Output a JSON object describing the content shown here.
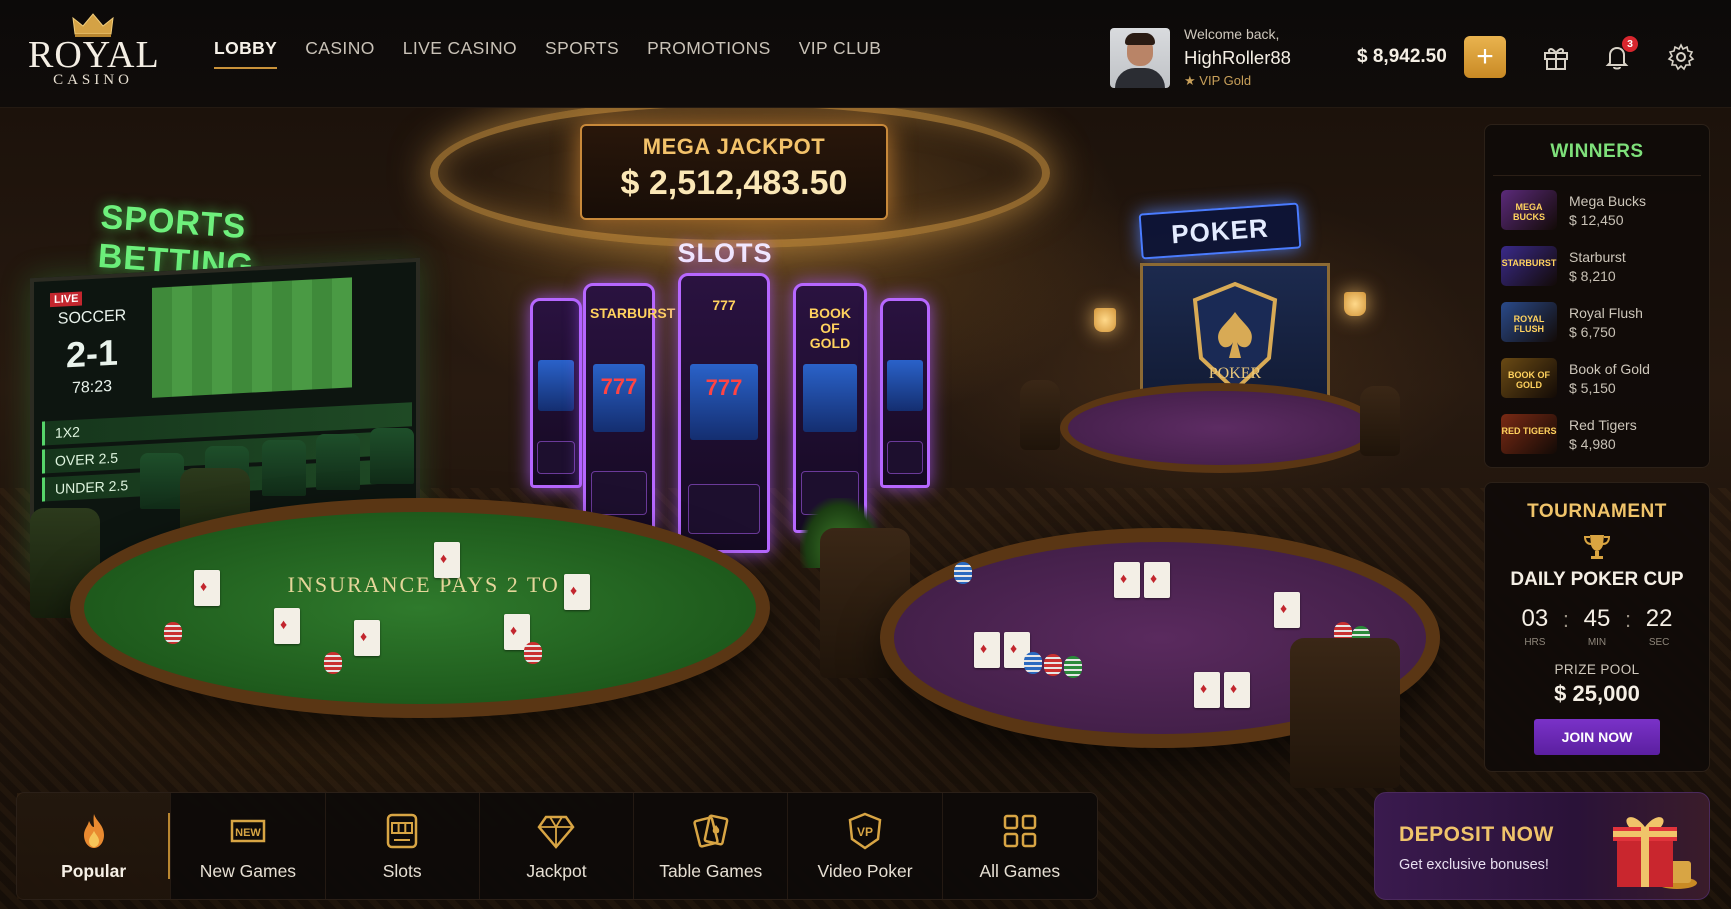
{
  "brand": {
    "name": "ROYAL",
    "sub": "CASINO"
  },
  "nav": [
    {
      "label": "LOBBY",
      "active": true
    },
    {
      "label": "CASINO",
      "active": false
    },
    {
      "label": "LIVE CASINO",
      "active": false
    },
    {
      "label": "SPORTS",
      "active": false
    },
    {
      "label": "PROMOTIONS",
      "active": false
    },
    {
      "label": "VIP CLUB",
      "active": false
    }
  ],
  "user": {
    "welcome": "Welcome back,",
    "username": "HighRoller88",
    "tier": "VIP Gold"
  },
  "wallet": {
    "balance": "$ 8,942.50",
    "add_label": "+"
  },
  "header_icons": {
    "gift": "gift-icon",
    "bell": "bell-icon",
    "settings": "gear-icon",
    "notification_count": "3"
  },
  "scene": {
    "jackpot_label": "MEGA JACKPOT",
    "jackpot_value": "$ 2,512,483.50",
    "slots_sign": "SLOTS",
    "poker_sign": "POKER",
    "poker_emblem": "POKER",
    "sports_sign": "SPORTS BETTING",
    "tv": {
      "live": "LIVE",
      "sport": "SOCCER",
      "score": "2-1",
      "time": "78:23",
      "odds": [
        "1X2",
        "OVER 2.5",
        "UNDER 2.5"
      ]
    },
    "slot_titles": [
      "STARBURST",
      "777",
      "BOOK OF GOLD"
    ],
    "blackjack_felt": "INSURANCE PAYS 2 TO 1"
  },
  "winners": {
    "title": "WINNERS",
    "items": [
      {
        "game": "Mega Bucks",
        "amount": "$ 12,450",
        "thumb": "MEGA BUCKS",
        "color": "#5b2a7a"
      },
      {
        "game": "Starburst",
        "amount": "$ 8,210",
        "thumb": "STARBURST",
        "color": "#3a2a8a"
      },
      {
        "game": "Royal Flush",
        "amount": "$ 6,750",
        "thumb": "ROYAL FLUSH",
        "color": "#2a4a8a"
      },
      {
        "game": "Book of Gold",
        "amount": "$ 5,150",
        "thumb": "BOOK OF GOLD",
        "color": "#6a4a14"
      },
      {
        "game": "Red Tigers",
        "amount": "$ 4,980",
        "thumb": "RED TIGERS",
        "color": "#7a2a14"
      }
    ]
  },
  "tournament": {
    "title": "TOURNAMENT",
    "name": "DAILY POKER CUP",
    "timer": {
      "hrs": "03",
      "min": "45",
      "sec": "22",
      "hrs_label": "HRS",
      "min_label": "MIN",
      "sec_label": "SEC"
    },
    "prize_label": "PRIZE POOL",
    "prize_value": "$ 25,000",
    "join_label": "JOIN NOW"
  },
  "categories": [
    {
      "label": "Popular",
      "icon": "flame-icon",
      "active": true
    },
    {
      "label": "New Games",
      "icon": "new-badge-icon",
      "active": false
    },
    {
      "label": "Slots",
      "icon": "slot-machine-icon",
      "active": false
    },
    {
      "label": "Jackpot",
      "icon": "diamond-icon",
      "active": false
    },
    {
      "label": "Table Games",
      "icon": "cards-icon",
      "active": false
    },
    {
      "label": "Video Poker",
      "icon": "vp-badge-icon",
      "active": false
    },
    {
      "label": "All Games",
      "icon": "grid-icon",
      "active": false
    }
  ],
  "deposit": {
    "title": "DEPOSIT NOW",
    "subtitle": "Get exclusive bonuses!"
  },
  "colors": {
    "accent_gold": "#e9b34f",
    "winners_green": "#7ee07a",
    "join_purple": "#6a28b4",
    "badge_red": "#d8262e"
  }
}
